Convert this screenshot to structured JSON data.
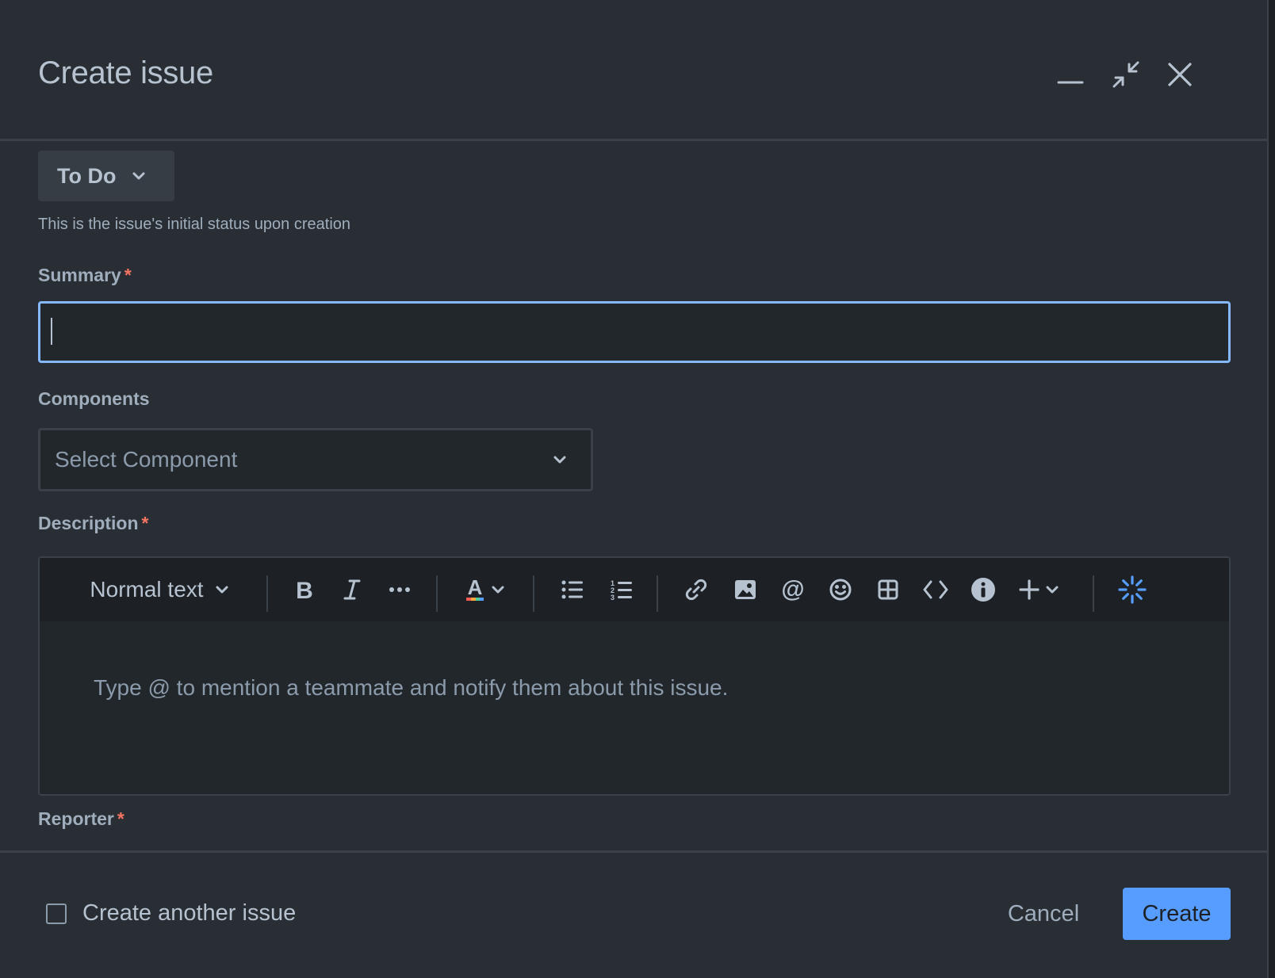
{
  "modal": {
    "title": "Create issue",
    "header_controls": {
      "minimize_icon": "minimize-icon",
      "collapse_icon": "collapse-icon",
      "close_icon": "close-icon"
    }
  },
  "status": {
    "value": "To Do",
    "helper": "This is the issue's initial status upon creation"
  },
  "summary": {
    "label": "Summary",
    "required_marker": "*",
    "value": ""
  },
  "components": {
    "label": "Components",
    "placeholder": "Select Component"
  },
  "description": {
    "label": "Description",
    "required_marker": "*",
    "toolbar": {
      "text_style": "Normal text",
      "icons": [
        "bold-icon",
        "italic-icon",
        "more-formatting-icon",
        "text-color-icon",
        "bullet-list-icon",
        "numbered-list-icon",
        "link-icon",
        "image-icon",
        "mention-icon",
        "emoji-icon",
        "table-icon",
        "code-icon",
        "info-panel-icon",
        "insert-icon",
        "ai-loading-icon"
      ]
    },
    "placeholder": "Type @ to mention a teammate and notify them about this issue."
  },
  "reporter": {
    "label": "Reporter",
    "required_marker": "*"
  },
  "footer": {
    "create_another_label": "Create another issue",
    "create_another_checked": false,
    "cancel_label": "Cancel",
    "create_label": "Create"
  },
  "colors": {
    "modal_bg": "#282e33",
    "accent": "#579dff",
    "focus_border": "#85b8ff",
    "required": "#f87462",
    "text": "#b6c2cf"
  }
}
